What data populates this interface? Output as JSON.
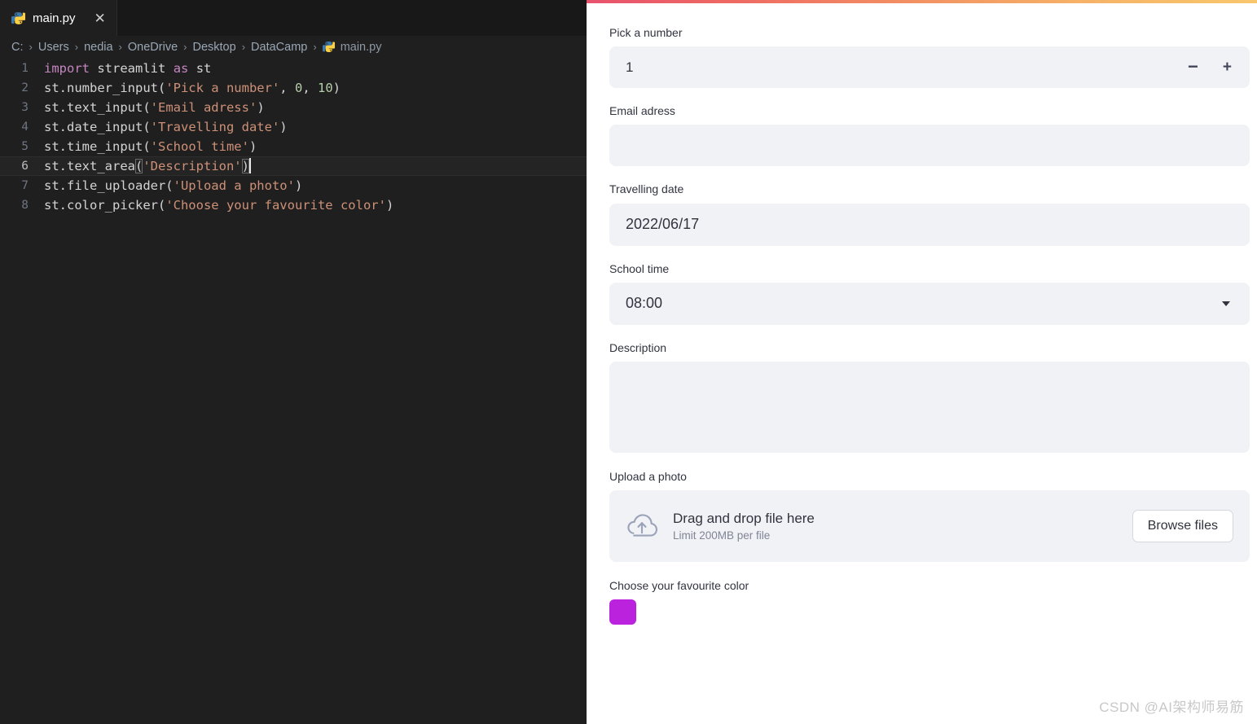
{
  "editor": {
    "tab": {
      "filename": "main.py",
      "icon": "python-icon",
      "close_icon": "close-icon"
    },
    "breadcrumb": {
      "items": [
        "C:",
        "Users",
        "nedia",
        "OneDrive",
        "Desktop",
        "DataCamp",
        "main.py"
      ],
      "separator": "›",
      "file_icon": "python-icon"
    },
    "lines": [
      {
        "n": "1",
        "tokens": [
          {
            "t": "import",
            "c": "kw"
          },
          {
            "t": " ",
            "c": "id"
          },
          {
            "t": "streamlit",
            "c": "id"
          },
          {
            "t": " ",
            "c": "id"
          },
          {
            "t": "as",
            "c": "kw"
          },
          {
            "t": " ",
            "c": "id"
          },
          {
            "t": "st",
            "c": "id"
          }
        ]
      },
      {
        "n": "2",
        "tokens": [
          {
            "t": "st.number_input(",
            "c": "id"
          },
          {
            "t": "'Pick a number'",
            "c": "str"
          },
          {
            "t": ", ",
            "c": "punc"
          },
          {
            "t": "0",
            "c": "num"
          },
          {
            "t": ", ",
            "c": "punc"
          },
          {
            "t": "10",
            "c": "num"
          },
          {
            "t": ")",
            "c": "punc"
          }
        ]
      },
      {
        "n": "3",
        "tokens": [
          {
            "t": "st.text_input(",
            "c": "id"
          },
          {
            "t": "'Email adress'",
            "c": "str"
          },
          {
            "t": ")",
            "c": "punc"
          }
        ]
      },
      {
        "n": "4",
        "tokens": [
          {
            "t": "st.date_input(",
            "c": "id"
          },
          {
            "t": "'Travelling date'",
            "c": "str"
          },
          {
            "t": ")",
            "c": "punc"
          }
        ]
      },
      {
        "n": "5",
        "tokens": [
          {
            "t": "st.time_input(",
            "c": "id"
          },
          {
            "t": "'School time'",
            "c": "str"
          },
          {
            "t": ")",
            "c": "punc"
          }
        ]
      },
      {
        "n": "6",
        "active": true,
        "tokens": [
          {
            "t": "st.text_area",
            "c": "id"
          },
          {
            "t": "(",
            "c": "punc",
            "bracket": true
          },
          {
            "t": "'Description'",
            "c": "str"
          },
          {
            "t": ")",
            "c": "punc",
            "bracket": true
          }
        ],
        "caret": true
      },
      {
        "n": "7",
        "tokens": [
          {
            "t": "st.file_uploader(",
            "c": "id"
          },
          {
            "t": "'Upload a photo'",
            "c": "str"
          },
          {
            "t": ")",
            "c": "punc"
          }
        ]
      },
      {
        "n": "8",
        "tokens": [
          {
            "t": "st.color_picker(",
            "c": "id"
          },
          {
            "t": "'Choose your favourite color'",
            "c": "str"
          },
          {
            "t": ")",
            "c": "punc"
          }
        ]
      }
    ],
    "colors": {
      "background": "#1f1f1f",
      "tabbar": "#181818",
      "active_line": "#242424",
      "keyword": "#c586c0",
      "string": "#ce9178",
      "number": "#b5cea8",
      "identifier": "#d4d4d4",
      "line_number": "#6e7681"
    }
  },
  "streamlit": {
    "accent_gradient_from": "#e8526e",
    "accent_gradient_to": "#f8c76c",
    "number_input": {
      "label": "Pick a number",
      "value": "1",
      "decrement_label": "−",
      "increment_label": "+"
    },
    "text_input": {
      "label": "Email adress",
      "value": "",
      "placeholder": ""
    },
    "date_input": {
      "label": "Travelling date",
      "value": "2022/06/17"
    },
    "time_input": {
      "label": "School time",
      "value": "08:00",
      "chevron_icon": "chevron-down-icon"
    },
    "text_area": {
      "label": "Description",
      "value": "",
      "placeholder": ""
    },
    "file_uploader": {
      "label": "Upload a photo",
      "icon": "cloud-upload-icon",
      "drop_text": "Drag and drop file here",
      "limit_text": "Limit 200MB per file",
      "browse_label": "Browse files"
    },
    "color_picker": {
      "label": "Choose your favourite color",
      "value": "#bb22dd"
    },
    "field_background": "#f0f2f6",
    "text_color": "#31333f"
  },
  "watermark": {
    "text": "CSDN @AI架构师易筋"
  }
}
